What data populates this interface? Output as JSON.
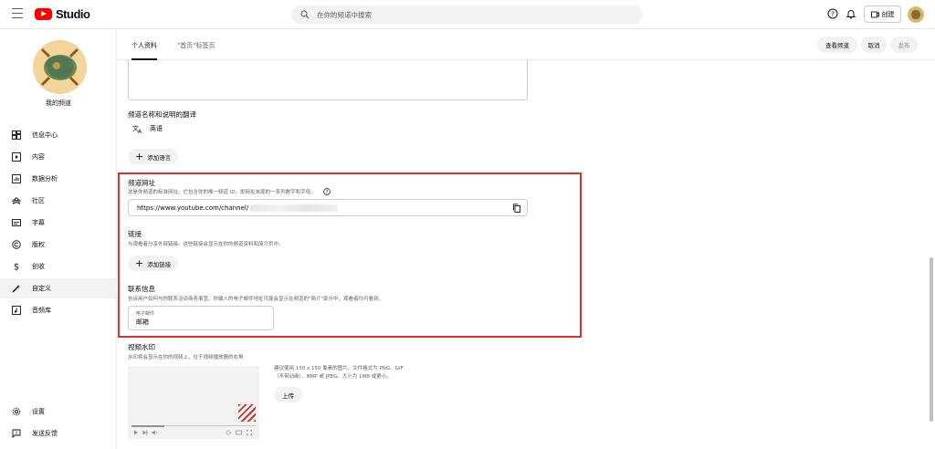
{
  "topbar": {
    "logo_text": "Studio",
    "search_placeholder": "在你的频道中搜索",
    "create_label": "创建"
  },
  "sidebar": {
    "channel_name": "我的频道",
    "items": [
      {
        "label": "信息中心",
        "icon": "dashboard-icon"
      },
      {
        "label": "内容",
        "icon": "content-icon"
      },
      {
        "label": "数据分析",
        "icon": "analytics-icon"
      },
      {
        "label": "社区",
        "icon": "community-icon"
      },
      {
        "label": "字幕",
        "icon": "subtitles-icon"
      },
      {
        "label": "版权",
        "icon": "copyright-icon"
      },
      {
        "label": "创收",
        "icon": "earn-icon"
      },
      {
        "label": "自定义",
        "icon": "customization-icon",
        "active": true
      },
      {
        "label": "音频库",
        "icon": "audio-library-icon"
      }
    ],
    "bottom": [
      {
        "label": "设置",
        "icon": "settings-icon"
      },
      {
        "label": "发送反馈",
        "icon": "feedback-icon"
      }
    ]
  },
  "tabs": {
    "profile": "个人资料",
    "home": "\"首页\"标签页"
  },
  "header_buttons": {
    "view_channel": "查看频道",
    "cancel": "取消",
    "publish": "发布"
  },
  "translation": {
    "title": "频道名称和说明的翻译",
    "language": "英语",
    "add_language": "添加语言"
  },
  "channel_url": {
    "title": "频道网址",
    "description": "这是你频道的标准网址。它包含你的唯一频道 ID，即网址末尾的一系列数字和字母。",
    "url_prefix": "https://www.youtube.com/channel/"
  },
  "links": {
    "title": "链接",
    "description": "与观看者分享外部链接。这些链接会显示在你的频道资料和简介页中。",
    "add_link": "添加链接"
  },
  "contact": {
    "title": "联系信息",
    "description": "告诉用户如何与你联系洽谈商务事宜。你输入的电子邮件地址可能会显示在频道的\"简介\"部分中，观看者均可看到。",
    "email_label": "电子邮件",
    "email_placeholder": "邮箱"
  },
  "watermark": {
    "title": "视频水印",
    "description": "水印将会显示在你的视频上，位于视频播放器的右角",
    "recommend_1": "建议使用 150 x 150 像素的图片。文件格式为 PNG、GIF",
    "recommend_2": "（不带动画）、BMP 或 JPEG。大小为 1MB 或更小。",
    "upload": "上传"
  },
  "colors": {
    "highlight": "#e52b2b",
    "brand_red": "#ff0000"
  }
}
